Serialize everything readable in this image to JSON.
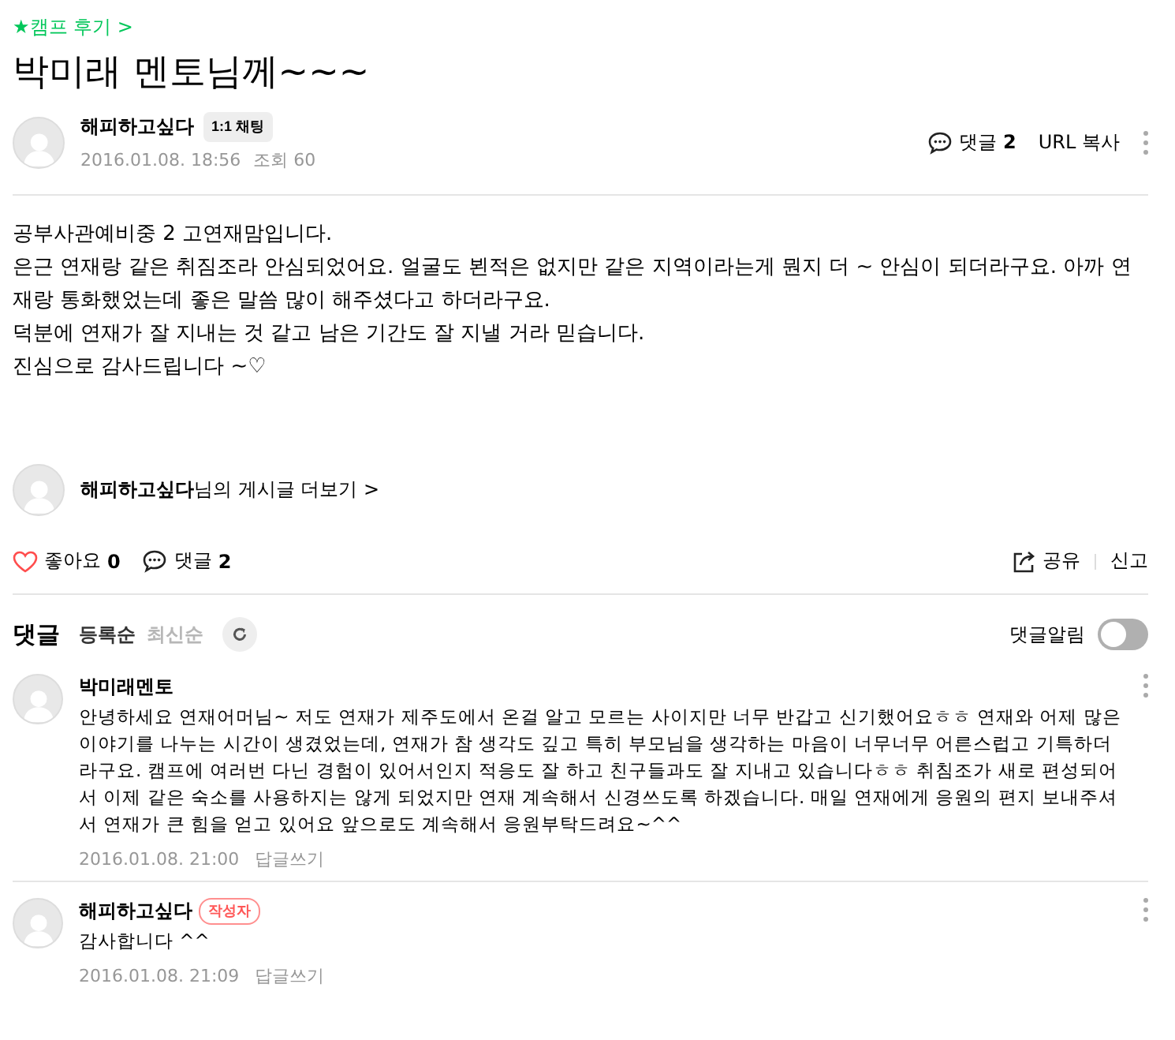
{
  "category": "★캠프 후기 >",
  "title": "박미래 멘토님께~~~",
  "author": {
    "name": "해피하고싶다",
    "chat_badge": "1:1 채팅",
    "date": "2016.01.08. 18:56",
    "views": "조회 60"
  },
  "header_actions": {
    "comments_label": "댓글",
    "comments_count": "2",
    "url_copy": "URL 복사"
  },
  "body": [
    "공부사관예비중 2 고연재맘입니다.",
    "은근 연재랑 같은 취짐조라 안심되었어요. 얼굴도 뵌적은 없지만 같은 지역이라는게 뭔지 더 ~ 안심이 되더라구요. 아까 연재랑 통화했었는데 좋은 말씀 많이 해주셨다고 하더라구요.",
    "덕분에 연재가 잘 지내는 것 같고 남은 기간도 잘 지낼 거라 믿습니다.",
    "진심으로 감사드립니다 ~♡"
  ],
  "more_posts": {
    "name": "해피하고싶다",
    "suffix": "님의 게시글 더보기 >"
  },
  "footer": {
    "like_label": "좋아요",
    "like_count": "0",
    "liked": false,
    "comments_label": "댓글",
    "comments_count": "2",
    "share": "공유",
    "report": "신고"
  },
  "comments_section": {
    "title": "댓글",
    "sorts": [
      {
        "label": "등록순",
        "selected": true
      },
      {
        "label": "최신순",
        "selected": false
      }
    ],
    "alert_label": "댓글알림",
    "alert_on": false
  },
  "comments": [
    {
      "author": "박미래멘토",
      "text": "안녕하세요 연재어머님~ 저도 연재가 제주도에서 온걸 알고 모르는 사이지만 너무 반갑고 신기했어요ㅎㅎ 연재와 어제 많은 이야기를 나누는 시간이 생겼었는데, 연재가 참 생각도 깊고 특히 부모님을 생각하는 마음이 너무너무 어른스럽고 기특하더라구요. 캠프에 여러번 다닌 경험이 있어서인지 적응도 잘 하고 친구들과도 잘 지내고 있습니다ㅎㅎ 취침조가 새로 편성되어서 이제 같은 숙소를 사용하지는 않게 되었지만 연재 계속해서 신경쓰도록 하겠습니다. 매일 연재에게 응원의 편지 보내주셔서 연재가 큰 힘을 얻고 있어요 앞으로도 계속해서 응원부탁드려요~^^",
      "date": "2016.01.08. 21:00",
      "reply": "답글쓰기"
    },
    {
      "author": "해피하고싶다",
      "badge": "작성자",
      "text": "감사합니다 ^^",
      "date": "2016.01.08. 21:09",
      "reply": "답글쓰기"
    }
  ]
}
